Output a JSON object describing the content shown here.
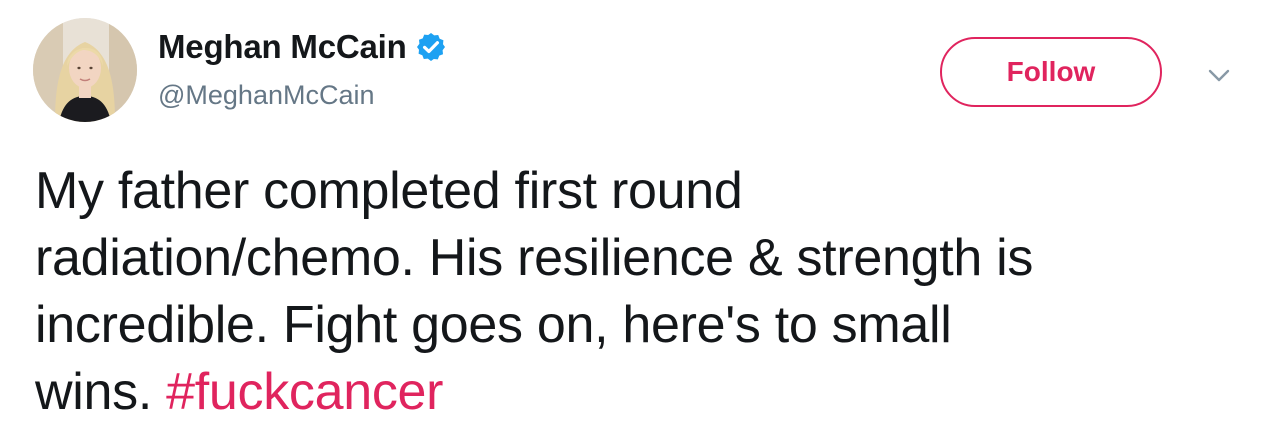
{
  "user": {
    "display_name": "Meghan McCain",
    "handle": "@MeghanMcCain",
    "verified": true,
    "avatar_icon": "profile-photo"
  },
  "follow_button": {
    "label": "Follow",
    "color": "#e0245e"
  },
  "menu_caret_icon": "chevron-down-icon",
  "tweet": {
    "lines": [
      "My father completed first round",
      "radiation/chemo. His resilience & strength is",
      "incredible. Fight goes on, here's to small"
    ],
    "last_line_text": "wins. ",
    "hashtag": "#fuckcancer",
    "hashtag_color": "#e0245e"
  },
  "colors": {
    "text": "#14171a",
    "secondary": "#657786",
    "verified_badge": "#1da1f2"
  }
}
